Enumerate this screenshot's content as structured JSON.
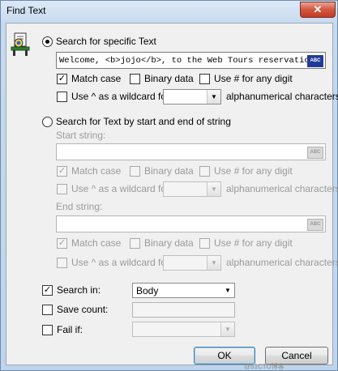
{
  "window": {
    "title": "Find Text",
    "close_glyph": "✕"
  },
  "icon": {
    "name": "find-text-icon"
  },
  "specific": {
    "radio_label": "Search for specific Text",
    "text_value": "Welcome, <b>jojo</b>, to the Web Tours reservation",
    "abc_label": "ABC",
    "match_case_label": "Match case",
    "match_case_checked": true,
    "binary_label": "Binary data",
    "hash_label": "Use # for any digit",
    "wildcard_label": "Use ^ as a wildcard for",
    "alnum_label": "alphanumerical characters",
    "selected": true
  },
  "bystring": {
    "radio_label": "Search for Text by start and end of string",
    "start_label": "Start string:",
    "start_value": "",
    "end_label": "End string:",
    "end_value": "",
    "abc_label": "ABC",
    "match_case_label": "Match case",
    "binary_label": "Binary data",
    "hash_label": "Use # for any digit",
    "wildcard_label": "Use ^ as a wildcard for",
    "alnum_label": "alphanumerical characters"
  },
  "search_in": {
    "label": "Search in:",
    "checked": true,
    "value": "Body"
  },
  "save_count": {
    "label": "Save count:",
    "checked": false,
    "value": ""
  },
  "fail_if": {
    "label": "Fail if:",
    "checked": false,
    "value": ""
  },
  "buttons": {
    "ok": "OK",
    "cancel": "Cancel"
  },
  "watermark": "@51CTO博客"
}
